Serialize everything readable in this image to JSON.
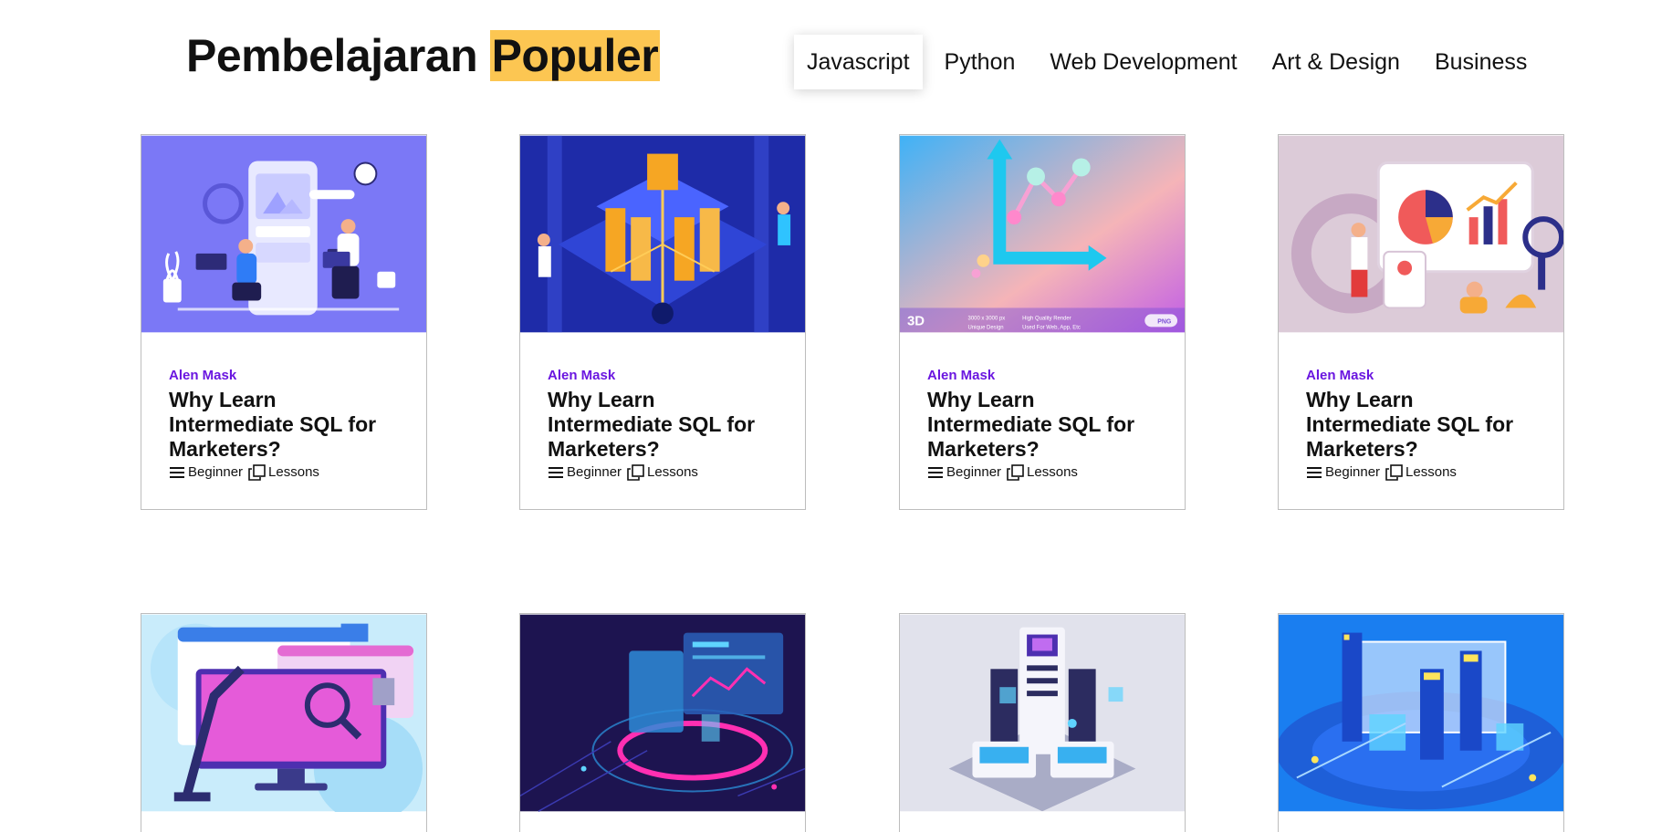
{
  "header": {
    "title_prefix": "Pembelajaran",
    "title_highlight": "Populer",
    "highlight_color": "#fcc652"
  },
  "tabs": [
    {
      "label": "Javascript",
      "active": true
    },
    {
      "label": "Python",
      "active": false
    },
    {
      "label": "Web Development",
      "active": false
    },
    {
      "label": "Art & Design",
      "active": false
    },
    {
      "label": "Business",
      "active": false
    }
  ],
  "accent_color": "#6a16e0",
  "cards": [
    {
      "author": "Alen Mask",
      "title": "Why Learn Intermediate SQL for Marketers?",
      "level": "Beginner",
      "lessons": "Lessons",
      "image": "app-development-illustration"
    },
    {
      "author": "Alen Mask",
      "title": "Why Learn Intermediate SQL for Marketers?",
      "level": "Beginner",
      "lessons": "Lessons",
      "image": "isometric-server-illustration"
    },
    {
      "author": "Alen Mask",
      "title": "Why Learn Intermediate SQL for Marketers?",
      "level": "Beginner",
      "lessons": "Lessons",
      "image": "3d-chart-illustration",
      "image_caption_lines": [
        "3D",
        "3000 x 3000 px",
        "High Quality Render",
        "Unique Design",
        "Used For Web, App, Etc",
        "PNG"
      ]
    },
    {
      "author": "Alen Mask",
      "title": "Why Learn Intermediate SQL for Marketers?",
      "level": "Beginner",
      "lessons": "Lessons",
      "image": "data-analytics-illustration"
    },
    {
      "image": "web-automation-illustration"
    },
    {
      "image": "dashboard-monitor-illustration"
    },
    {
      "image": "data-center-illustration"
    },
    {
      "image": "blue-isometric-city-illustration"
    }
  ]
}
